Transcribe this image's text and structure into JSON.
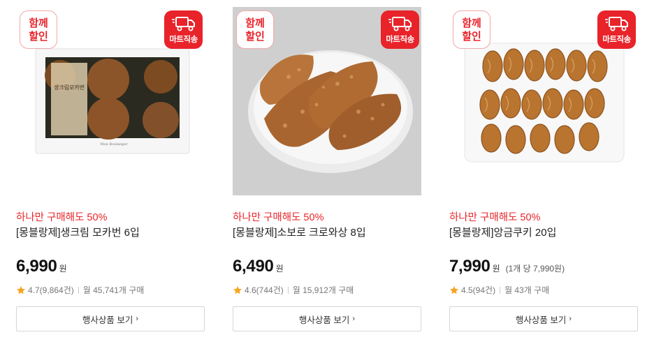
{
  "colors": {
    "accent": "#e8242a",
    "star": "#f5a623",
    "text": "#222222",
    "muted": "#777777"
  },
  "badges": {
    "together_line1": "함께",
    "together_line2": "할인",
    "mart_label": "마트직송",
    "mart_icon": "truck-icon"
  },
  "products": [
    {
      "image_name": "mocha-bun-box-image",
      "promo": "하나만 구매해도 50%",
      "title": "[몽블랑제]생크림 모카번 6입",
      "price": "6,990",
      "won": "원",
      "unit_price": "",
      "rating": "4.7(9,864건)",
      "monthly": "월 45,741개 구매",
      "button": "행사상품 보기",
      "button_chevron": "›"
    },
    {
      "image_name": "soboro-croissant-image",
      "promo": "하나만 구매해도 50%",
      "title": "[몽블랑제]소보로 크로와상 8입",
      "price": "6,490",
      "won": "원",
      "unit_price": "",
      "rating": "4.6(744건)",
      "monthly": "월 15,912개 구매",
      "button": "행사상품 보기",
      "button_chevron": "›"
    },
    {
      "image_name": "angeum-cookie-image",
      "promo": "하나만 구매해도 50%",
      "title": "[몽블랑제]앙금쿠키 20입",
      "price": "7,990",
      "won": "원",
      "unit_price": "(1개 당 7,990원)",
      "rating": "4.5(94건)",
      "monthly": "월 43개 구매",
      "button": "행사상품 보기",
      "button_chevron": "›"
    }
  ]
}
